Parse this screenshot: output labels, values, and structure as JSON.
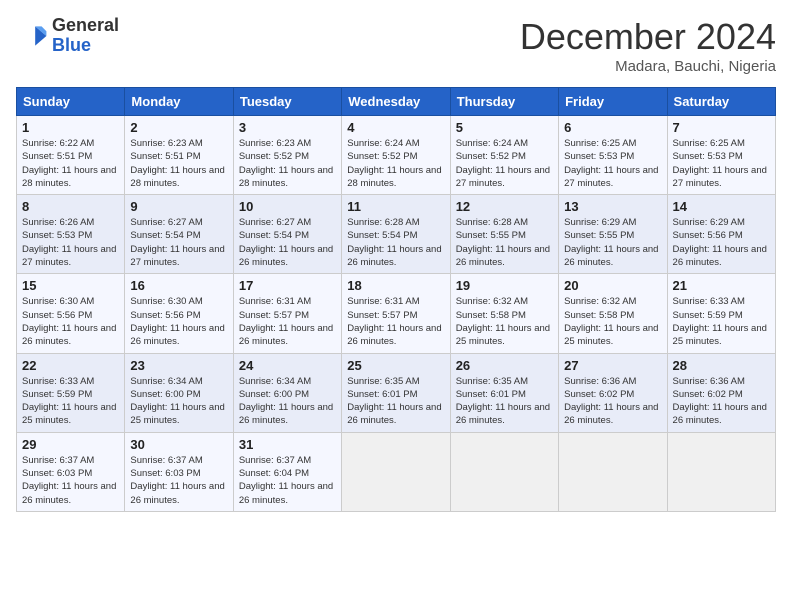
{
  "header": {
    "logo_general": "General",
    "logo_blue": "Blue",
    "month_title": "December 2024",
    "location": "Madara, Bauchi, Nigeria"
  },
  "weekdays": [
    "Sunday",
    "Monday",
    "Tuesday",
    "Wednesday",
    "Thursday",
    "Friday",
    "Saturday"
  ],
  "weeks": [
    [
      {
        "day": "1",
        "sunrise": "6:22 AM",
        "sunset": "5:51 PM",
        "daylight": "11 hours and 28 minutes."
      },
      {
        "day": "2",
        "sunrise": "6:23 AM",
        "sunset": "5:51 PM",
        "daylight": "11 hours and 28 minutes."
      },
      {
        "day": "3",
        "sunrise": "6:23 AM",
        "sunset": "5:52 PM",
        "daylight": "11 hours and 28 minutes."
      },
      {
        "day": "4",
        "sunrise": "6:24 AM",
        "sunset": "5:52 PM",
        "daylight": "11 hours and 28 minutes."
      },
      {
        "day": "5",
        "sunrise": "6:24 AM",
        "sunset": "5:52 PM",
        "daylight": "11 hours and 27 minutes."
      },
      {
        "day": "6",
        "sunrise": "6:25 AM",
        "sunset": "5:53 PM",
        "daylight": "11 hours and 27 minutes."
      },
      {
        "day": "7",
        "sunrise": "6:25 AM",
        "sunset": "5:53 PM",
        "daylight": "11 hours and 27 minutes."
      }
    ],
    [
      {
        "day": "8",
        "sunrise": "6:26 AM",
        "sunset": "5:53 PM",
        "daylight": "11 hours and 27 minutes."
      },
      {
        "day": "9",
        "sunrise": "6:27 AM",
        "sunset": "5:54 PM",
        "daylight": "11 hours and 27 minutes."
      },
      {
        "day": "10",
        "sunrise": "6:27 AM",
        "sunset": "5:54 PM",
        "daylight": "11 hours and 26 minutes."
      },
      {
        "day": "11",
        "sunrise": "6:28 AM",
        "sunset": "5:54 PM",
        "daylight": "11 hours and 26 minutes."
      },
      {
        "day": "12",
        "sunrise": "6:28 AM",
        "sunset": "5:55 PM",
        "daylight": "11 hours and 26 minutes."
      },
      {
        "day": "13",
        "sunrise": "6:29 AM",
        "sunset": "5:55 PM",
        "daylight": "11 hours and 26 minutes."
      },
      {
        "day": "14",
        "sunrise": "6:29 AM",
        "sunset": "5:56 PM",
        "daylight": "11 hours and 26 minutes."
      }
    ],
    [
      {
        "day": "15",
        "sunrise": "6:30 AM",
        "sunset": "5:56 PM",
        "daylight": "11 hours and 26 minutes."
      },
      {
        "day": "16",
        "sunrise": "6:30 AM",
        "sunset": "5:56 PM",
        "daylight": "11 hours and 26 minutes."
      },
      {
        "day": "17",
        "sunrise": "6:31 AM",
        "sunset": "5:57 PM",
        "daylight": "11 hours and 26 minutes."
      },
      {
        "day": "18",
        "sunrise": "6:31 AM",
        "sunset": "5:57 PM",
        "daylight": "11 hours and 26 minutes."
      },
      {
        "day": "19",
        "sunrise": "6:32 AM",
        "sunset": "5:58 PM",
        "daylight": "11 hours and 25 minutes."
      },
      {
        "day": "20",
        "sunrise": "6:32 AM",
        "sunset": "5:58 PM",
        "daylight": "11 hours and 25 minutes."
      },
      {
        "day": "21",
        "sunrise": "6:33 AM",
        "sunset": "5:59 PM",
        "daylight": "11 hours and 25 minutes."
      }
    ],
    [
      {
        "day": "22",
        "sunrise": "6:33 AM",
        "sunset": "5:59 PM",
        "daylight": "11 hours and 25 minutes."
      },
      {
        "day": "23",
        "sunrise": "6:34 AM",
        "sunset": "6:00 PM",
        "daylight": "11 hours and 25 minutes."
      },
      {
        "day": "24",
        "sunrise": "6:34 AM",
        "sunset": "6:00 PM",
        "daylight": "11 hours and 26 minutes."
      },
      {
        "day": "25",
        "sunrise": "6:35 AM",
        "sunset": "6:01 PM",
        "daylight": "11 hours and 26 minutes."
      },
      {
        "day": "26",
        "sunrise": "6:35 AM",
        "sunset": "6:01 PM",
        "daylight": "11 hours and 26 minutes."
      },
      {
        "day": "27",
        "sunrise": "6:36 AM",
        "sunset": "6:02 PM",
        "daylight": "11 hours and 26 minutes."
      },
      {
        "day": "28",
        "sunrise": "6:36 AM",
        "sunset": "6:02 PM",
        "daylight": "11 hours and 26 minutes."
      }
    ],
    [
      {
        "day": "29",
        "sunrise": "6:37 AM",
        "sunset": "6:03 PM",
        "daylight": "11 hours and 26 minutes."
      },
      {
        "day": "30",
        "sunrise": "6:37 AM",
        "sunset": "6:03 PM",
        "daylight": "11 hours and 26 minutes."
      },
      {
        "day": "31",
        "sunrise": "6:37 AM",
        "sunset": "6:04 PM",
        "daylight": "11 hours and 26 minutes."
      },
      null,
      null,
      null,
      null
    ]
  ]
}
